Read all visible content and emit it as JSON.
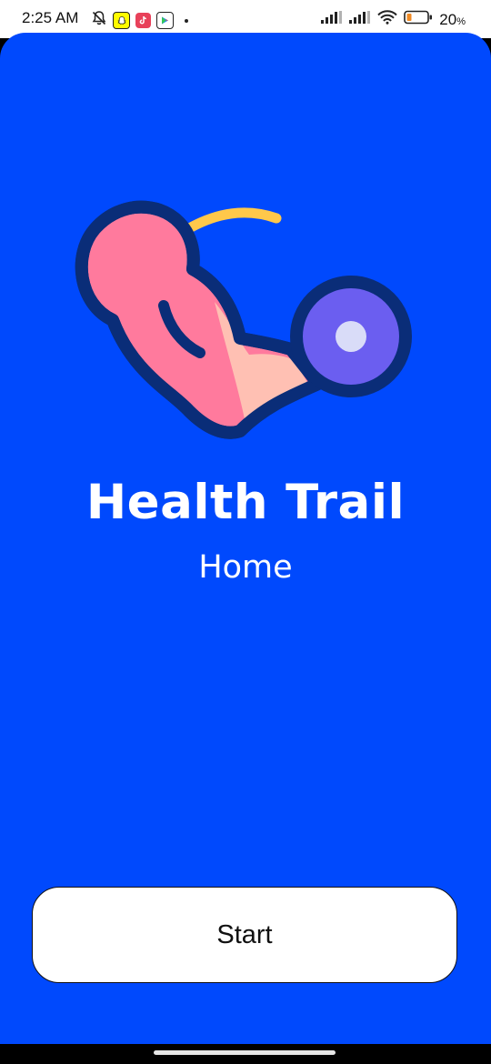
{
  "status_bar": {
    "time": "2:25 AM",
    "battery_percent": "20",
    "battery_unit": "%",
    "icons_left": [
      "muted-notification-icon",
      "snapchat-icon",
      "tiktok-icon",
      "play-store-icon"
    ],
    "icons_right": [
      "signal-icon",
      "signal-icon",
      "wifi-icon",
      "battery-icon"
    ]
  },
  "screen": {
    "title": "Health Trail",
    "subtitle": "Home",
    "start_label": "Start",
    "illustration_icon": "flexing-arm-dumbbell-icon"
  },
  "colors": {
    "background": "#0049fd",
    "button_bg": "#ffffff",
    "text_on_bg": "#ffffff"
  }
}
